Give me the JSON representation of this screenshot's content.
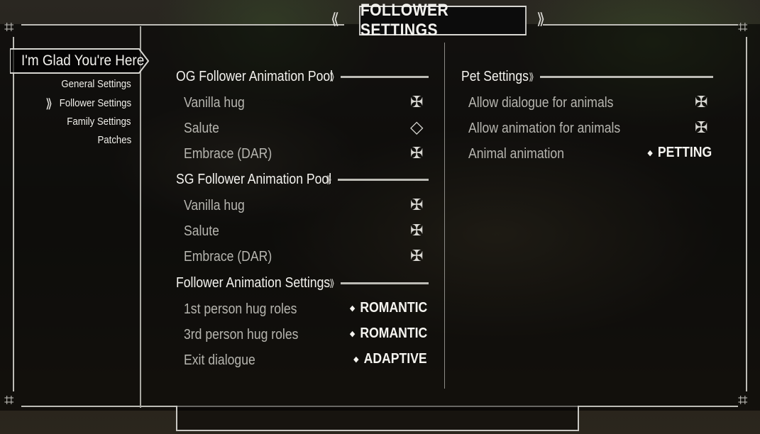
{
  "title": "FOLLOWER SETTINGS",
  "mod_name": "I'm Glad You're Here",
  "sidebar": {
    "items": [
      {
        "label": "General Settings"
      },
      {
        "label": "Follower Settings"
      },
      {
        "label": "Family Settings"
      },
      {
        "label": "Patches"
      }
    ],
    "selected_icon": "knot-selector-icon"
  },
  "left_column": {
    "sections": [
      {
        "header": "OG Follower Animation Pool",
        "rows": [
          {
            "label": "Vanilla hug",
            "state": "checked"
          },
          {
            "label": "Salute",
            "state": "unchecked"
          },
          {
            "label": "Embrace (DAR)",
            "state": "checked"
          }
        ]
      },
      {
        "header": "SG Follower Animation Pool",
        "rows": [
          {
            "label": "Vanilla hug",
            "state": "checked"
          },
          {
            "label": "Salute",
            "state": "checked"
          },
          {
            "label": "Embrace (DAR)",
            "state": "checked"
          }
        ]
      },
      {
        "header": "Follower Animation Settings",
        "rows": [
          {
            "label": "1st person hug roles",
            "value": "ROMANTIC"
          },
          {
            "label": "3rd person hug roles",
            "value": "ROMANTIC"
          },
          {
            "label": "Exit dialogue",
            "value": "ADAPTIVE"
          }
        ]
      }
    ]
  },
  "right_column": {
    "sections": [
      {
        "header": "Pet Settings",
        "rows": [
          {
            "label": "Allow dialogue for animals",
            "state": "checked"
          },
          {
            "label": "Allow animation for animals",
            "state": "checked"
          },
          {
            "label": "Animal animation",
            "value": "PETTING"
          }
        ]
      }
    ]
  },
  "icons": {
    "checked": "checked-knot-icon",
    "unchecked": "unchecked-diamond-icon",
    "dropdown": "dropdown-dot-icon"
  },
  "colors": {
    "frame": "#bdbcb6",
    "label_dim": "#b6b5af",
    "text_bright": "#f3f2ee"
  }
}
